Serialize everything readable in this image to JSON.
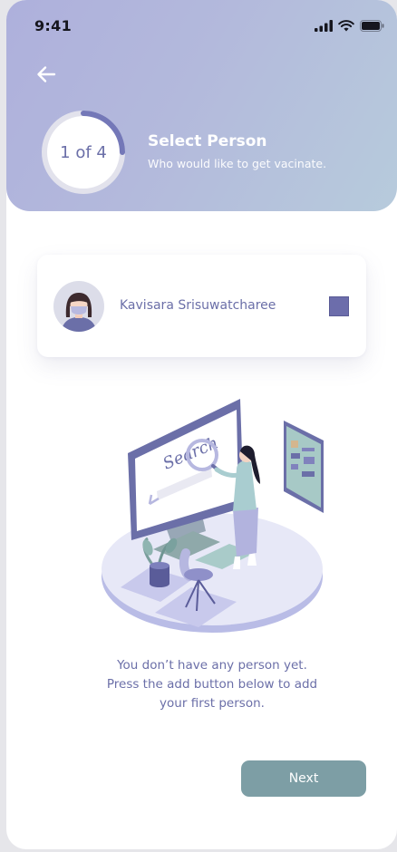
{
  "status_bar": {
    "time": "9:41"
  },
  "header": {
    "step": "1 of 4",
    "step_progress": 0.25,
    "title": "Select Person",
    "subtitle": "Who would like to get vacinate."
  },
  "person": {
    "name": "Kavisara Srisuwatcharee",
    "selected": true
  },
  "illustration": {
    "search_text": "Search"
  },
  "empty_state": {
    "line1": "You don’t have any person yet.",
    "line2": "Press the add button below to add",
    "line3": "your first person."
  },
  "next_button": {
    "label": "Next"
  },
  "colors": {
    "accent": "#6b6fa8",
    "button": "#7d9ea5",
    "header_start": "#aeb0dc",
    "header_end": "#b7cbdc"
  }
}
